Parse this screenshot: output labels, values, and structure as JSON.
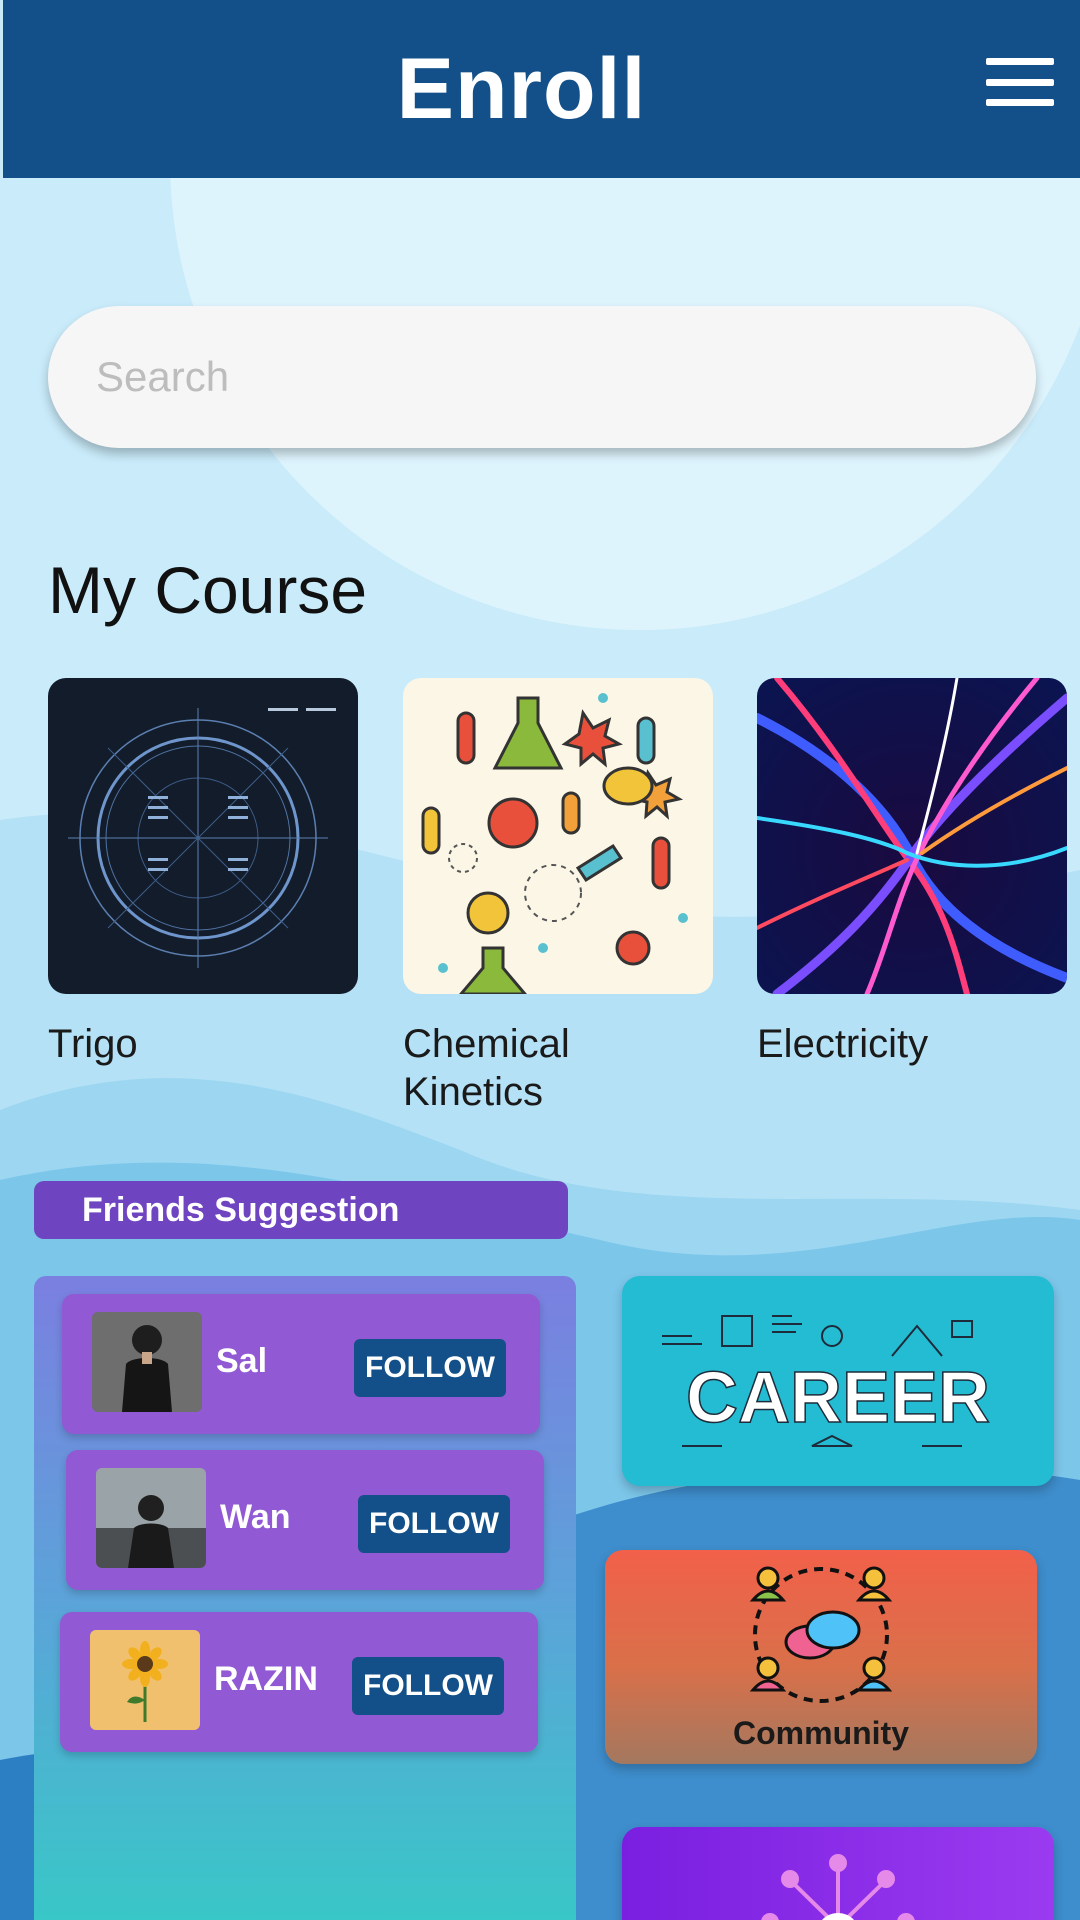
{
  "header": {
    "title": "Enroll",
    "menu_icon": "hamburger-menu-icon"
  },
  "search": {
    "placeholder": "Search",
    "value": ""
  },
  "my_course": {
    "title": "My Course",
    "courses": [
      {
        "label": "Trigo",
        "thumbnail": "trigonometry-circle-image"
      },
      {
        "label": "Chemical\nKinetics",
        "thumbnail": "chemistry-doodle-image"
      },
      {
        "label": "Electricity",
        "thumbnail": "electric-light-streaks-image"
      }
    ]
  },
  "friends": {
    "title": "Friends Suggestion",
    "items": [
      {
        "name": "Sal",
        "follow_label": "FOLLOW"
      },
      {
        "name": "Wan",
        "follow_label": "FOLLOW"
      },
      {
        "name": "RAZIN",
        "follow_label": "FOLLOW"
      }
    ]
  },
  "tiles": {
    "career": {
      "text": "CAREER"
    },
    "community": {
      "label": "Community"
    }
  },
  "colors": {
    "header": "#135089",
    "friends_tag": "#6f44c0",
    "friend_card": "#9259d4",
    "follow_button": "#135089",
    "career_tile": "#24bcd2",
    "community_tile": "#f2604a"
  }
}
